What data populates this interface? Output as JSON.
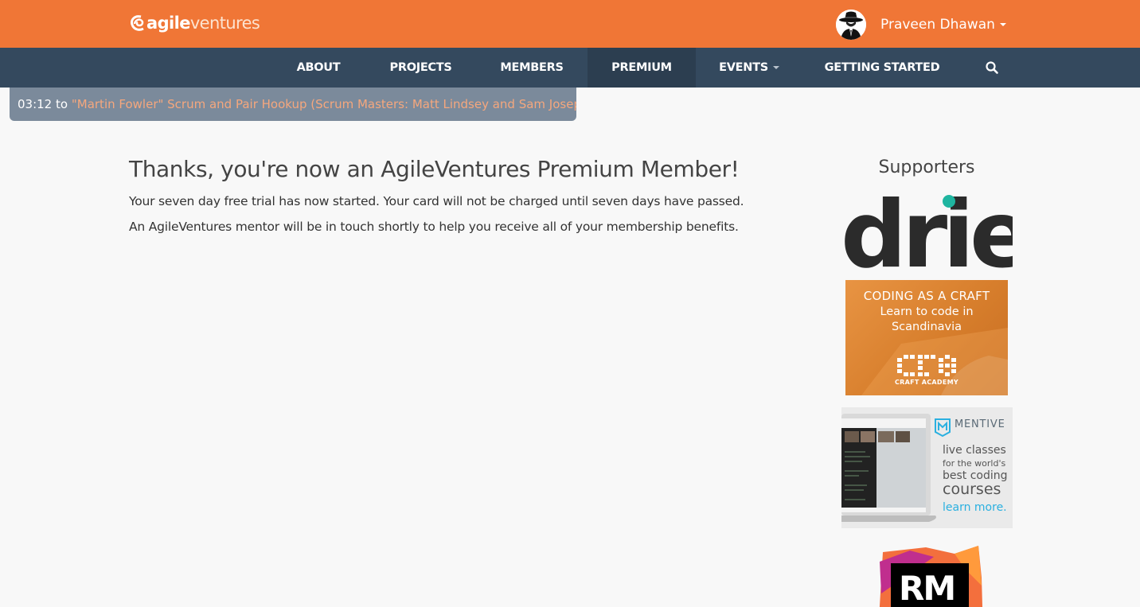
{
  "header": {
    "logo": {
      "part1": "agile",
      "part2": "ventures"
    },
    "user": {
      "name": "Praveen Dhawan"
    }
  },
  "nav": {
    "items": [
      {
        "label": "ABOUT"
      },
      {
        "label": "PROJECTS"
      },
      {
        "label": "MEMBERS"
      },
      {
        "label": "PREMIUM",
        "active": true
      },
      {
        "label": "EVENTS",
        "dropdown": true
      },
      {
        "label": "GETTING STARTED"
      }
    ],
    "search_icon": "search-icon"
  },
  "event_bar": {
    "time": "03:12",
    "connector": "to",
    "event_title": "\"Martin Fowler\" Scrum and Pair Hookup (Scrum Masters: Matt Lindsey and Sam Joseph)"
  },
  "main": {
    "title": "Thanks, you're now an AgileVentures Premium Member!",
    "paragraphs": [
      "Your seven day free trial has now started. Your card will not be charged until seven days have passed.",
      "An AgileVentures mentor will be in touch shortly to help you receive all of your membership benefits."
    ]
  },
  "sidebar": {
    "title": "Supporters",
    "sponsors": {
      "drie": {
        "wordmark": "drie"
      },
      "craft": {
        "line1": "CODING AS A CRAFT",
        "line2": "Learn to code in",
        "line3": "Scandinavia",
        "name": "CRAFT ACADEMY"
      },
      "mentive": {
        "brand": "MENTIVE",
        "line1": "live classes",
        "line2": "for the world's",
        "line3": "best coding",
        "line4": "courses",
        "more": "learn more."
      },
      "rubymine": {
        "wordmark": "RM"
      }
    }
  },
  "colors": {
    "header_bg": "#f07636",
    "nav_bg": "#34495e",
    "nav_active_bg": "#2c3e50",
    "event_bar_bg": "#7b8a9b",
    "event_link": "#f5a77d",
    "page_bg": "#f8f8f8",
    "drie_teal": "#1fb5a0",
    "mentive_blue": "#2ab0e0"
  }
}
